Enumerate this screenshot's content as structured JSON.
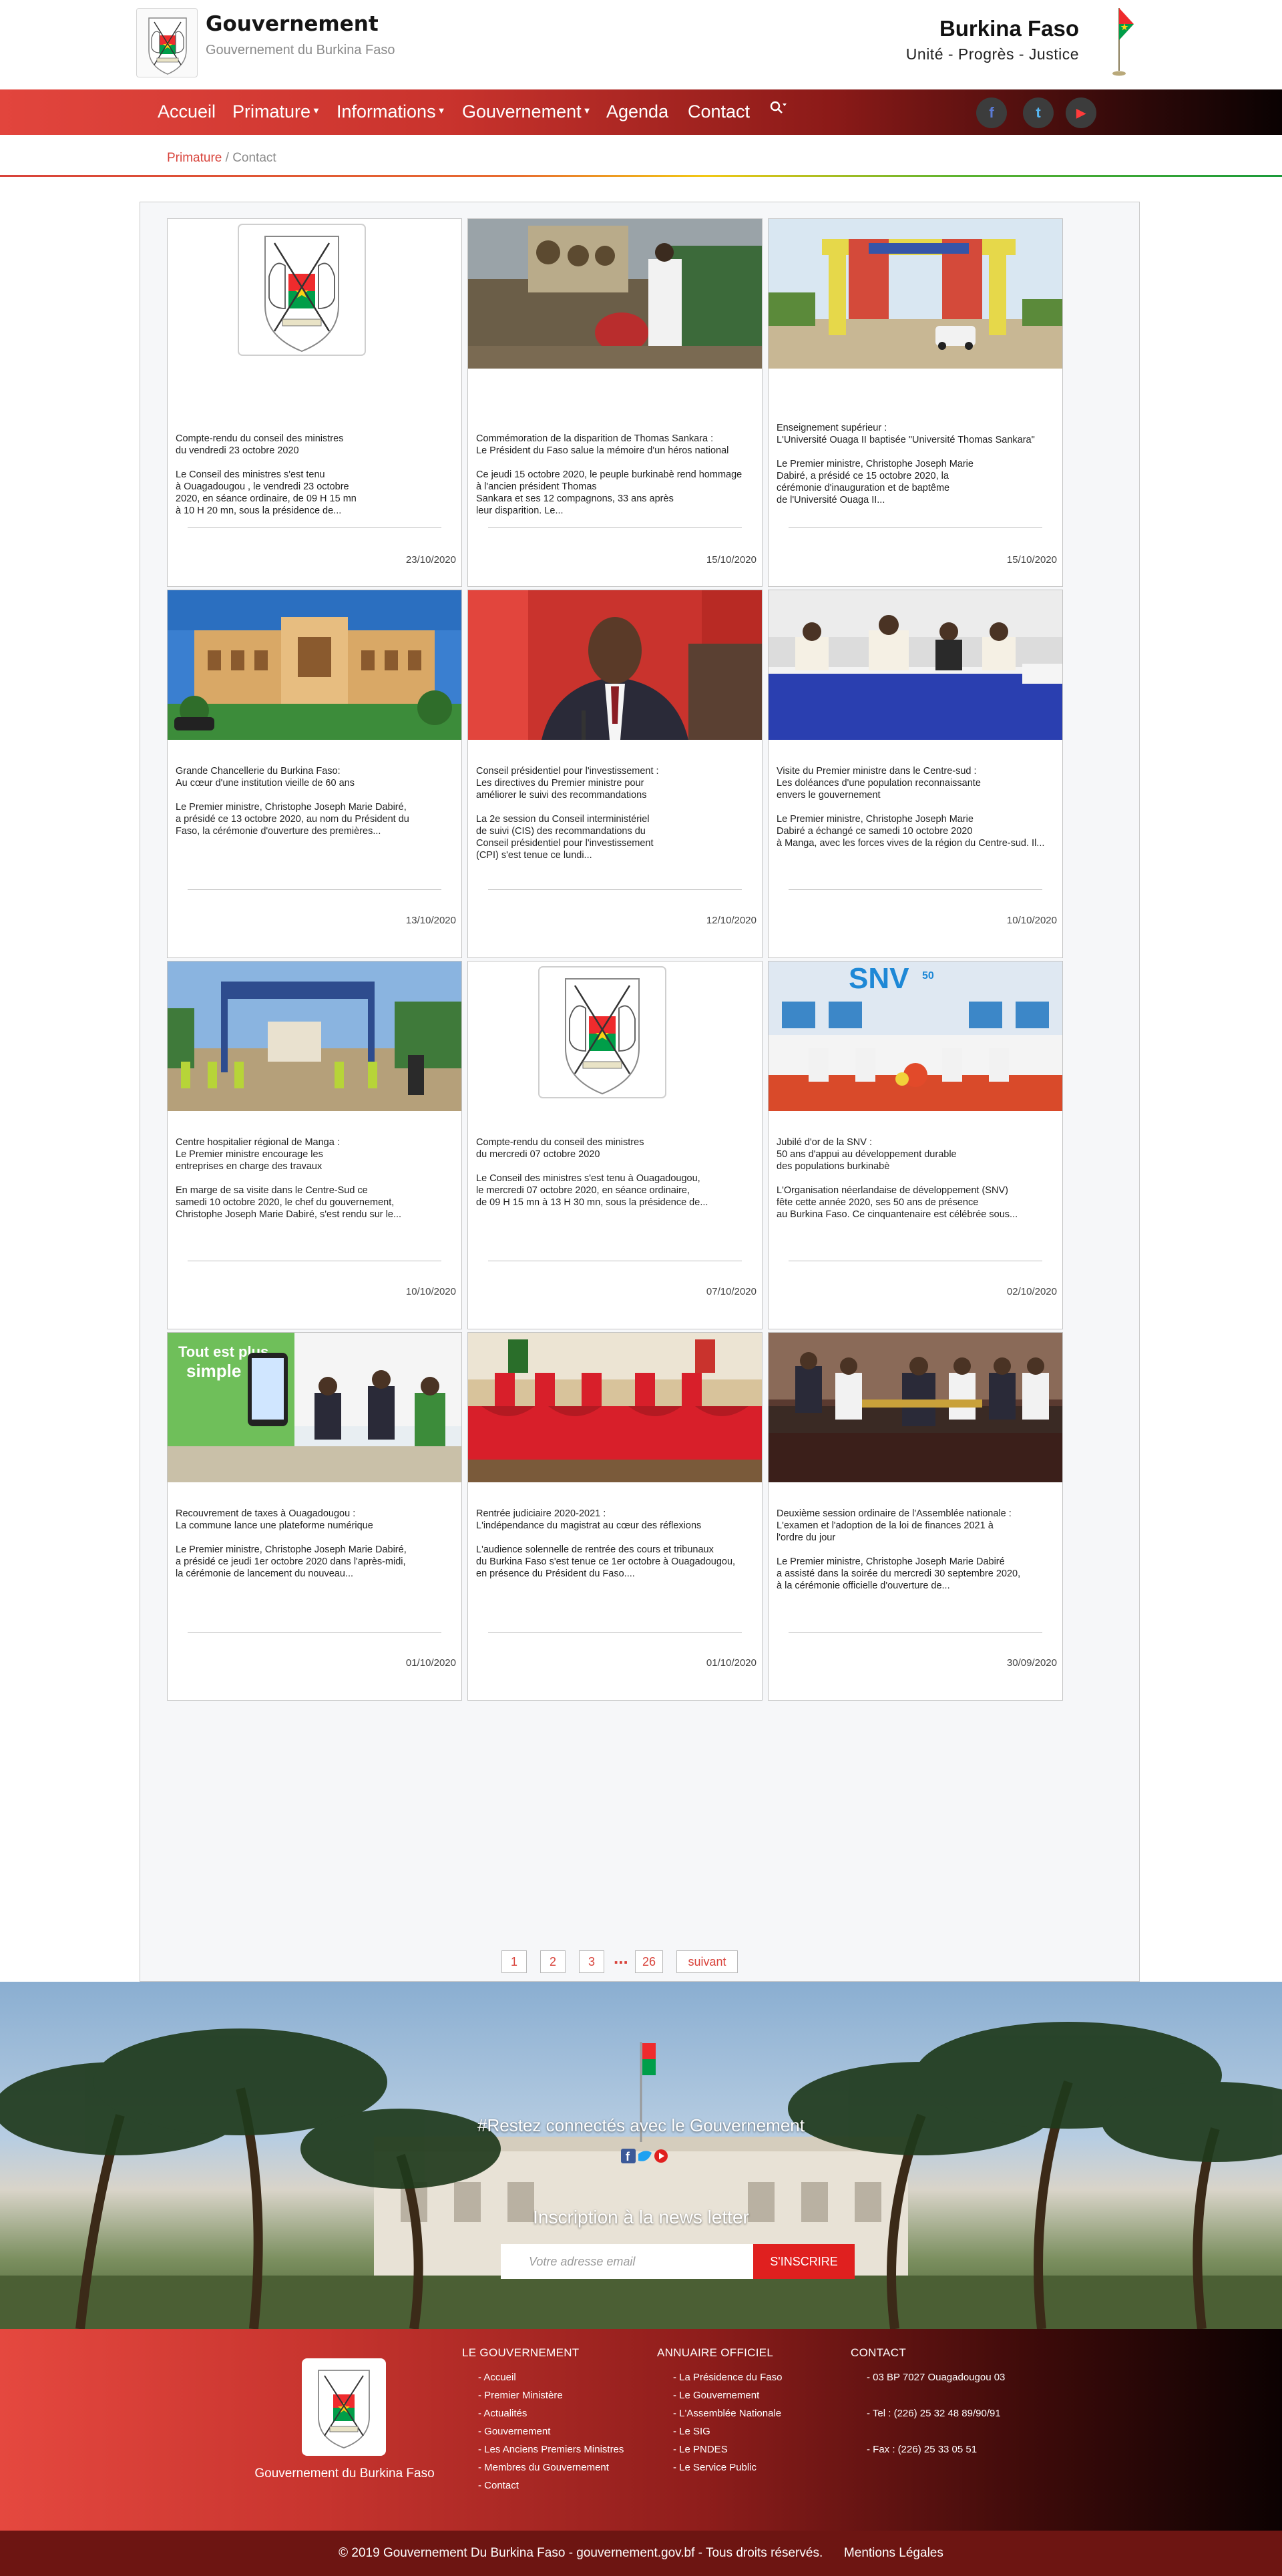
{
  "header": {
    "title": "Gouvernement",
    "subtitle": "Gouvernement du Burkina Faso",
    "country": "Burkina Faso",
    "motto": "Unité - Progrès - Justice"
  },
  "nav": {
    "items": [
      {
        "label": "Accueil",
        "dropdown": false
      },
      {
        "label": "Primature",
        "dropdown": true
      },
      {
        "label": "Informations",
        "dropdown": true
      },
      {
        "label": "Gouvernement",
        "dropdown": true
      },
      {
        "label": "Agenda",
        "dropdown": false
      },
      {
        "label": "Contact",
        "dropdown": false
      }
    ],
    "search_icon": "search-icon",
    "social": [
      {
        "name": "facebook-icon",
        "glyph": "f",
        "color": "#3b5998"
      },
      {
        "name": "twitter-icon",
        "glyph": "t",
        "color": "#1da1f2"
      },
      {
        "name": "youtube-icon",
        "glyph": "▶",
        "color": "#e0201f"
      }
    ]
  },
  "breadcrumb": {
    "link": "Primature",
    "separator": " / ",
    "current": "Contact"
  },
  "cards": [
    {
      "image": "coat-of-arms",
      "text": "Compte-rendu du conseil des ministres\n du vendredi 23 octobre 2020\n\nLe Conseil des ministres s'est tenu\n à Ouagadougou , le vendredi 23 octobre\n 2020, en séance ordinaire, de 09 H 15 mn\n à 10 H 20 mn, sous la présidence de...",
      "date": "23/10/2020"
    },
    {
      "image": "photo-memorial",
      "text": "Commémoration de la disparition de Thomas Sankara :\n Le Président du Faso salue la mémoire d'un héros national\n\nCe jeudi 15 octobre 2020, le peuple burkinabè rend hommage\n à l'ancien président Thomas\n Sankara et ses 12 compagnons, 33 ans après\n leur disparition. Le...",
      "date": "15/10/2020"
    },
    {
      "image": "photo-university-gate",
      "text": "Enseignement supérieur :\nL'Université Ouaga II baptisée \"Université Thomas Sankara\"\n\nLe Premier ministre, Christophe Joseph Marie\n Dabiré, a présidé ce 15 octobre 2020, la\n cérémonie d'inauguration et de baptême\n de l'Université Ouaga II...",
      "date": "15/10/2020"
    },
    {
      "image": "photo-chancellery",
      "text": "Grande Chancellerie du Burkina Faso:\n Au cœur d'une institution vieille de 60 ans\n\nLe Premier ministre, Christophe Joseph Marie Dabiré,\n a présidé ce 13 octobre 2020, au nom du Président du\n Faso, la cérémonie d'ouverture des premières...",
      "date": "13/10/2020"
    },
    {
      "image": "photo-portrait",
      "text": "Conseil présidentiel pour l'investissement :\n Les directives du Premier ministre pour\n améliorer le suivi des recommandations\n\nLa 2e session du Conseil interministériel\n de suivi (CIS) des recommandations du\n Conseil présidentiel pour l'investissement\n (CPI) s'est tenue ce lundi...",
      "date": "12/10/2020"
    },
    {
      "image": "photo-meeting-blue",
      "text": "Visite du Premier ministre dans le Centre-sud :\n Les doléances d'une population reconnaissante\n envers le gouvernement\n\nLe Premier ministre, Christophe Joseph Marie\n Dabiré a échangé ce samedi 10 octobre 2020\n à Manga, avec les forces vives de la région du Centre-sud. Il...",
      "date": "10/10/2020"
    },
    {
      "image": "photo-hospital-site",
      "text": "Centre hospitalier régional de Manga :\n Le Premier ministre encourage les\n entreprises en charge des travaux\n\nEn marge de sa visite dans le Centre-Sud ce\n samedi 10 octobre 2020, le chef du gouvernement,\n Christophe Joseph Marie Dabiré, s'est rendu sur le...",
      "date": "10/10/2020"
    },
    {
      "image": "coat-of-arms",
      "text": "Compte-rendu du conseil des ministres\n du mercredi 07 octobre 2020\n\nLe Conseil des ministres s'est tenu à Ouagadougou,\n le mercredi 07 octobre 2020, en séance ordinaire,\n de 09 H 15 mn à 13 H 30 mn, sous la présidence de...",
      "date": "07/10/2020"
    },
    {
      "image": "photo-snv",
      "text": "Jubilé d'or de la SNV :\n 50 ans d'appui au développement durable\n des populations burkinabè\n\nL'Organisation néerlandaise de développement (SNV)\n fête cette année 2020, ses 50 ans de présence\n au Burkina Faso. Ce cinquantenaire est célébrée sous...",
      "date": "02/10/2020"
    },
    {
      "image": "photo-tax-launch",
      "text": "Recouvrement de taxes à Ouagadougou :\n La commune lance une plateforme numérique\n\nLe Premier ministre, Christophe Joseph Marie Dabiré,\n a présidé ce jeudi 1er octobre 2020 dans l'après-midi,\n la cérémonie de lancement du nouveau...",
      "date": "01/10/2020"
    },
    {
      "image": "photo-judicial",
      "text": "Rentrée judiciaire 2020-2021 :\n L'indépendance du magistrat au cœur des réflexions\n\nL'audience solennelle de rentrée des cours et tribunaux\n du Burkina Faso s'est tenue ce 1er octobre à Ouagadougou,\n en présence du Président du Faso....",
      "date": "01/10/2020"
    },
    {
      "image": "photo-assembly",
      "text": "Deuxième session ordinaire de l'Assemblée nationale :\nL'examen et l'adoption de la loi de finances 2021 à\n l'ordre du jour\n\nLe Premier ministre, Christophe Joseph Marie Dabiré\n a assisté dans la soirée du mercredi 30 septembre 2020,\n à la cérémonie officielle d'ouverture de...",
      "date": "30/09/2020"
    }
  ],
  "pagination": {
    "pages": [
      "1",
      "2",
      "3"
    ],
    "ellipsis": "...",
    "last": "26",
    "next": "suivant"
  },
  "newsletter": {
    "headline": "#Restez connectés avec le Gouvernement",
    "title": "Inscription à la news letter",
    "placeholder": "Votre adresse email",
    "button": "S'INSCRIRE"
  },
  "footer": {
    "logo_caption": "Gouvernement du Burkina Faso",
    "columns": [
      {
        "title": "LE GOUVERNEMENT",
        "links": [
          "- Accueil",
          "- Premier Ministère",
          "- Actualités",
          "- Gouvernement",
          "- Les Anciens Premiers Ministres",
          "- Membres du Gouvernement",
          "- Contact"
        ]
      },
      {
        "title": "ANNUAIRE OFFICIEL",
        "links": [
          "- La Présidence du Faso",
          "- Le Gouvernement",
          "- L'Assemblée Nationale",
          "- Le SIG",
          "- Le PNDES",
          "- Le Service Public"
        ]
      },
      {
        "title": "CONTACT",
        "links": [
          "- 03 BP 7027 Ouagadougou 03",
          "- Tel : (226) 25 32 48 89/90/91",
          "- Fax : (226) 25 33 05 51"
        ]
      }
    ],
    "copyright": "© 2019 Gouvernement Du Burkina Faso - gouvernement.gov.bf - Tous droits réservés.",
    "legal": "Mentions Légales"
  },
  "colors": {
    "accent_red": "#d8423a",
    "flag_red": "#ef2b2d",
    "flag_green": "#009e49",
    "flag_star": "#fcd116"
  }
}
